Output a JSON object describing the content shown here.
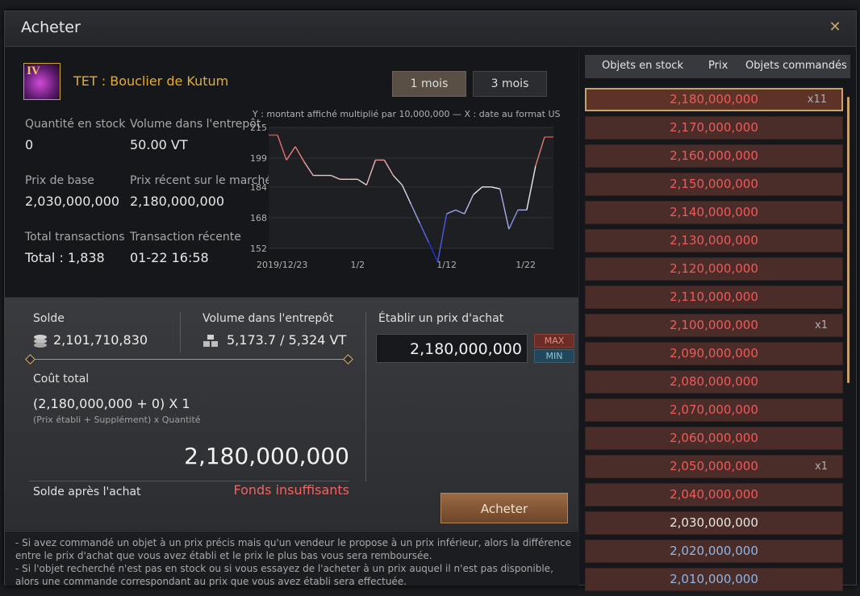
{
  "window": {
    "title": "Acheter"
  },
  "item": {
    "tier": "IV",
    "name": "TET : Bouclier de Kutum"
  },
  "periods": [
    "1 mois",
    "3 mois"
  ],
  "stats": {
    "stock_label": "Quantité en stock",
    "stock_value": "0",
    "volume_label": "Volume dans l'entrepôt",
    "volume_value": "50.00 VT",
    "base_label": "Prix de base",
    "base_value": "2,030,000,000",
    "recent_label": "Prix récent sur le marché",
    "recent_value": "2,180,000,000",
    "total_tx_label": "Total transactions",
    "total_tx_value": "Total : 1,838",
    "recent_tx_label": "Transaction récente",
    "recent_tx_value": "01-22 16:58"
  },
  "chart_data": {
    "type": "line",
    "title": "Y : montant affiché multiplié par 10,000,000 — X : date au format US",
    "x_tick_labels": [
      "2019/12/23",
      "1/2",
      "1/12",
      "1/22"
    ],
    "x_tick_positions": [
      0,
      10,
      20,
      30
    ],
    "y_ticks": [
      152,
      168,
      184,
      199,
      215
    ],
    "ylim": [
      152,
      215
    ],
    "x": [
      0,
      1,
      2,
      3,
      4,
      5,
      6,
      7,
      8,
      9,
      10,
      11,
      12,
      13,
      14,
      15,
      16,
      17,
      18,
      19,
      20,
      21,
      22,
      23,
      24,
      25,
      26,
      27,
      28,
      29,
      30,
      31,
      32
    ],
    "values": [
      211,
      211,
      198,
      205,
      197,
      190,
      190,
      190,
      188,
      188,
      188,
      185,
      198,
      198,
      190,
      185,
      175,
      165,
      155,
      145,
      170,
      172,
      170,
      180,
      184,
      184,
      183,
      162,
      172,
      172,
      195,
      210,
      210
    ],
    "colors": {
      "high": "#e03030",
      "low": "#2a3ee0"
    }
  },
  "purchase": {
    "balance_label": "Solde",
    "balance_value": "2,101,710,830",
    "wh_label": "Volume dans l'entrepôt",
    "wh_value": "5,173.7 / 5,324 VT",
    "set_price_label": "Établir un prix d'achat",
    "set_price_value": "2,180,000,000",
    "max_label": "MAX",
    "min_label": "MIN",
    "total_cost_label": "Coût total",
    "formula": "(2,180,000,000 + 0) X 1",
    "formula_hint": "(Prix établi + Supplément) x Quantité",
    "total_value": "2,180,000,000",
    "balance_after_label": "Solde après l'achat",
    "insufficient": "Fonds insuffisants",
    "buy_label": "Acheter"
  },
  "notes": [
    "- Si avez commandé un objet à un prix précis mais qu'un vendeur le propose à un prix inférieur, alors la différence entre le prix d'achat que vous avez établi et le prix le plus bas vous sera remboursée.",
    "- Si l'objet recherché n'est pas en stock ou si vous essayez de l'acheter à un prix auquel il n'est pas disponible, alors une commande correspondant au prix que vous avez établi sera effectuée."
  ],
  "orders": {
    "headers": {
      "stock": "Objets en stock",
      "price": "Prix",
      "ordered": "Objets commandés"
    },
    "rows": [
      {
        "price": "2,180,000,000",
        "qty": "x11",
        "color": "red",
        "selected": true
      },
      {
        "price": "2,170,000,000",
        "qty": "",
        "color": "red"
      },
      {
        "price": "2,160,000,000",
        "qty": "",
        "color": "red"
      },
      {
        "price": "2,150,000,000",
        "qty": "",
        "color": "red"
      },
      {
        "price": "2,140,000,000",
        "qty": "",
        "color": "red"
      },
      {
        "price": "2,130,000,000",
        "qty": "",
        "color": "red"
      },
      {
        "price": "2,120,000,000",
        "qty": "",
        "color": "red"
      },
      {
        "price": "2,110,000,000",
        "qty": "",
        "color": "red"
      },
      {
        "price": "2,100,000,000",
        "qty": "x1",
        "color": "red"
      },
      {
        "price": "2,090,000,000",
        "qty": "",
        "color": "red"
      },
      {
        "price": "2,080,000,000",
        "qty": "",
        "color": "red"
      },
      {
        "price": "2,070,000,000",
        "qty": "",
        "color": "red"
      },
      {
        "price": "2,060,000,000",
        "qty": "",
        "color": "red"
      },
      {
        "price": "2,050,000,000",
        "qty": "x1",
        "color": "red"
      },
      {
        "price": "2,040,000,000",
        "qty": "",
        "color": "red"
      },
      {
        "price": "2,030,000,000",
        "qty": "",
        "color": "white"
      },
      {
        "price": "2,020,000,000",
        "qty": "",
        "color": "blue"
      },
      {
        "price": "2,010,000,000",
        "qty": "",
        "color": "blue"
      }
    ]
  }
}
